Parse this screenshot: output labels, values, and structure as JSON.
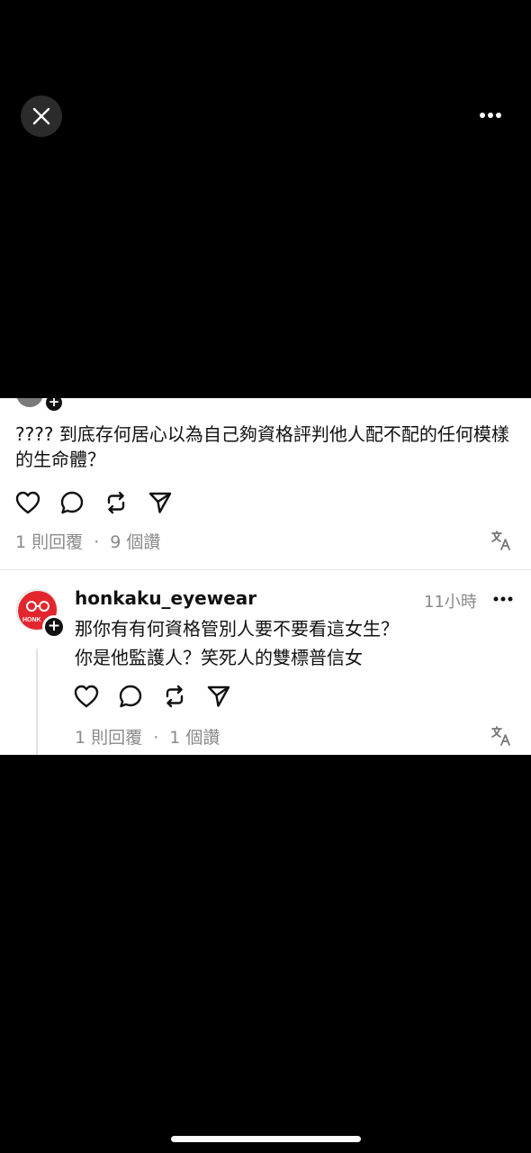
{
  "viewer": {
    "close_icon": "close-icon",
    "more_icon": "more-horizontal-icon"
  },
  "post": {
    "text": "???? 到底存何居心以為自己夠資格評判他人配不配的任何模樣的生命體？",
    "replies": "1 則回覆",
    "separator": "·",
    "views": "9 個讚"
  },
  "reply": {
    "username": "honkaku_eyewear",
    "time": "11小時",
    "avatar_text": "HONK",
    "lines": [
      "那你有有何資格管別人要不要看這女生？",
      "你是他監護人？笑死人的雙標普信女"
    ],
    "replies": "1 則回覆",
    "separator": "·",
    "views": "1 個讚"
  },
  "colors": {
    "background": "#000000",
    "card": "#ffffff",
    "text": "#111111",
    "muted": "#8a8a8a",
    "brand_red": "#e3262e"
  }
}
